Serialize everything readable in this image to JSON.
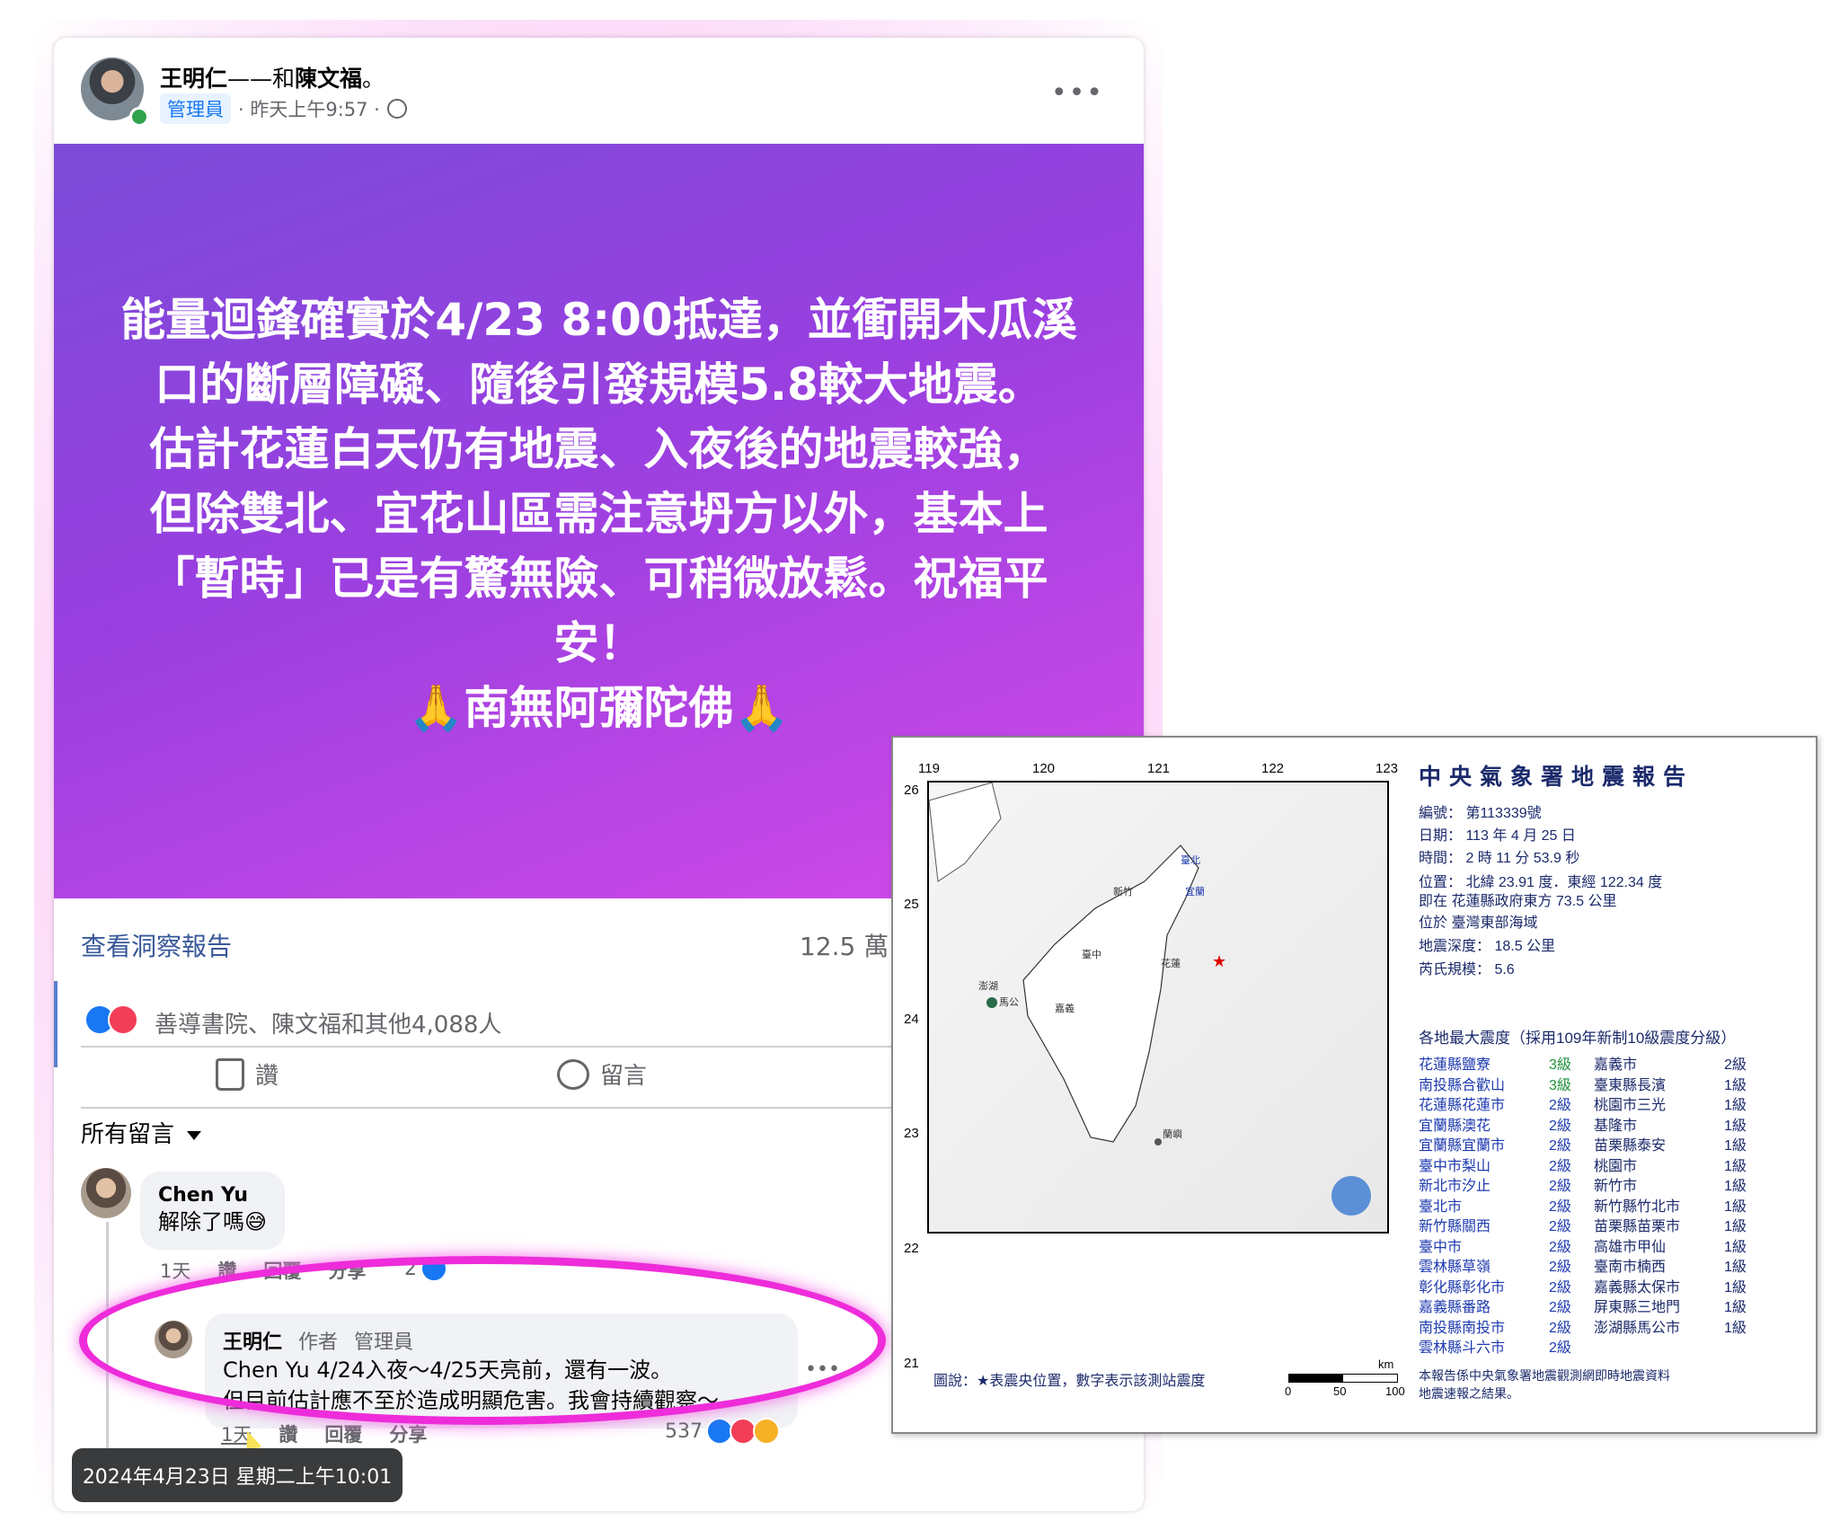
{
  "post": {
    "author": "王明仁",
    "with_text": "——和",
    "tagged": "陳文福",
    "period": "。",
    "badge": "管理員",
    "time": "· 昨天上午9:57 ·",
    "more_icon": "more-horizontal-icon",
    "banner_lines": [
      "能量迴鋒確實於4/23 8:00抵達，並衝開木瓜溪",
      "口的斷層障礙、隨後引發規模5.8較大地震。",
      "估計花蓮白天仍有地震、入夜後的地震較強，",
      "但除雙北、宜花山區需注意坍方以外，基本上",
      "「暫時」已是有驚無險、可稍微放鬆。祝福平",
      "安！",
      "🙏南無阿彌陀佛🙏"
    ],
    "insights_link": "查看洞察報告",
    "views": "12.5 萬",
    "reactions_text": "善導書院、陳文福和其他4,088人",
    "like_label": "讚",
    "comment_label": "留言",
    "sort_label": "所有留言"
  },
  "comments": [
    {
      "name": "Chen Yu",
      "text": "解除了嗎😅",
      "age": "1天",
      "like": "讚",
      "reply": "回覆",
      "share": "分享",
      "count": "2"
    },
    {
      "name": "王明仁",
      "role_author": "作者",
      "role_admin": "管理員",
      "line1": "Chen Yu 4/24入夜～4/25天亮前，還有一波。",
      "line2": "但目前估計應不至於造成明顯危害。我會持續觀察～",
      "age": "1天",
      "like": "讚",
      "reply": "回覆",
      "share": "分享",
      "count": "537"
    }
  ],
  "tooltip": "2024年4月23日 星期二上午10:01",
  "report": {
    "title": "中央氣象署地震報告",
    "lon_ticks": [
      "119",
      "120",
      "121",
      "122",
      "123"
    ],
    "lat_ticks": [
      "26",
      "25",
      "24",
      "23",
      "22",
      "21"
    ],
    "number": "編號：  第113339號",
    "date": "日期：  113 年 4 月 25 日",
    "time": "時間：  2 時 11 分 53.9 秒",
    "location": "位置：  北緯 23.91 度．東經 122.34 度",
    "near": "即在  花蓮縣政府東方 73.5 公里",
    "area": "位於  臺灣東部海域",
    "depth": "地震深度：  18.5 公里",
    "magnitude": "芮氏規模：  5.6",
    "intensity_header": "各地最大震度（採用109年新制10級震度分級）",
    "left_col": [
      [
        "花蓮縣鹽寮",
        "3級"
      ],
      [
        "南投縣合歡山",
        "3級"
      ],
      [
        "花蓮縣花蓮市",
        "2級"
      ],
      [
        "宜蘭縣澳花",
        "2級"
      ],
      [
        "宜蘭縣宜蘭市",
        "2級"
      ],
      [
        "臺中市梨山",
        "2級"
      ],
      [
        "新北市汐止",
        "2級"
      ],
      [
        "臺北市",
        "2級"
      ],
      [
        "新竹縣關西",
        "2級"
      ],
      [
        "臺中市",
        "2級"
      ],
      [
        "雲林縣草嶺",
        "2級"
      ],
      [
        "彰化縣彰化市",
        "2級"
      ],
      [
        "嘉義縣番路",
        "2級"
      ],
      [
        "南投縣南投市",
        "2級"
      ],
      [
        "雲林縣斗六市",
        "2級"
      ]
    ],
    "right_col": [
      [
        "嘉義市",
        "2級"
      ],
      [
        "臺東縣長濱",
        "1級"
      ],
      [
        "桃園市三光",
        "1級"
      ],
      [
        "基隆市",
        "1級"
      ],
      [
        "苗栗縣泰安",
        "1級"
      ],
      [
        "桃園市",
        "1級"
      ],
      [
        "新竹市",
        "1級"
      ],
      [
        "新竹縣竹北市",
        "1級"
      ],
      [
        "苗栗縣苗栗市",
        "1級"
      ],
      [
        "高雄市甲仙",
        "1級"
      ],
      [
        "臺南市楠西",
        "1級"
      ],
      [
        "嘉義縣太保市",
        "1級"
      ],
      [
        "屏東縣三地門",
        "1級"
      ],
      [
        "澎湖縣馬公市",
        "1級"
      ]
    ],
    "legend": "圖說：★表震央位置，數字表示該測站震度",
    "scale_unit": "km",
    "scale_labels": [
      "0",
      "50",
      "100"
    ],
    "footer1": "本報告係中央氣象署地震觀測網即時地震資料",
    "footer2": "地震速報之結果。",
    "map_labels": [
      "臺北",
      "宜蘭",
      "新竹",
      "臺中",
      "花蓮",
      "嘉義",
      "澎湖",
      "馬公",
      "蘭嶼"
    ],
    "colors": {
      "green": "#1f8f3a",
      "blue": "#1f3bb0",
      "navy": "#1b2a6b",
      "epicenter": "#e00000"
    }
  }
}
